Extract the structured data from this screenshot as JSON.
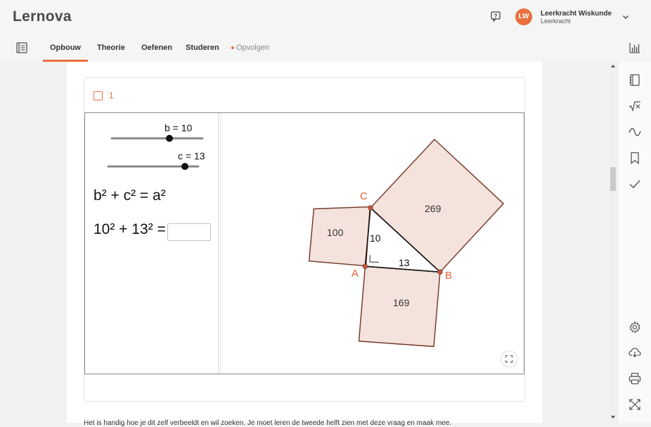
{
  "app": {
    "logo": "Lernova"
  },
  "user": {
    "initials": "LW",
    "name": "Leerkracht Wiskunde",
    "role": "Leerkracht"
  },
  "nav": {
    "tabs": [
      {
        "label": "Opbouw",
        "active": true
      },
      {
        "label": "Theorie"
      },
      {
        "label": "Oefenen"
      },
      {
        "label": "Studeren"
      },
      {
        "label": "Opvolgen"
      }
    ]
  },
  "exercise": {
    "number": "1",
    "slider_b_label": "b = 10",
    "slider_b_value": 10,
    "slider_c_label": "c = 13",
    "slider_c_value": 13,
    "formula_general": "b² + c² = a²",
    "formula_numeric": "10² + 13² =",
    "answer_value": ""
  },
  "geometry": {
    "vertex_a": "A",
    "vertex_b": "B",
    "vertex_c": "C",
    "side_ac_label": "10",
    "side_ab_label": "13",
    "square_ac_area": "100",
    "square_ab_area": "169",
    "square_bc_area": "269"
  },
  "below_text": "Het is handig hoe je dit zelf verbeeldt en wil zoeken. Je moet leren de tweede helft zien met deze vraag en maak mee.",
  "colors": {
    "accent": "#e8703e",
    "square_fill": "#f4e2dc",
    "square_stroke": "#7a3e2e"
  },
  "icons": {
    "help": "help-icon",
    "chevron": "chevron-down-icon",
    "book": "book-icon",
    "chart": "bar-chart-icon",
    "rail": [
      "notebook-icon",
      "sqrt-icon",
      "wave-icon",
      "bookmark-icon",
      "check-icon",
      "gear-icon",
      "cloud-download-icon",
      "printer-icon",
      "expand-icon"
    ]
  }
}
